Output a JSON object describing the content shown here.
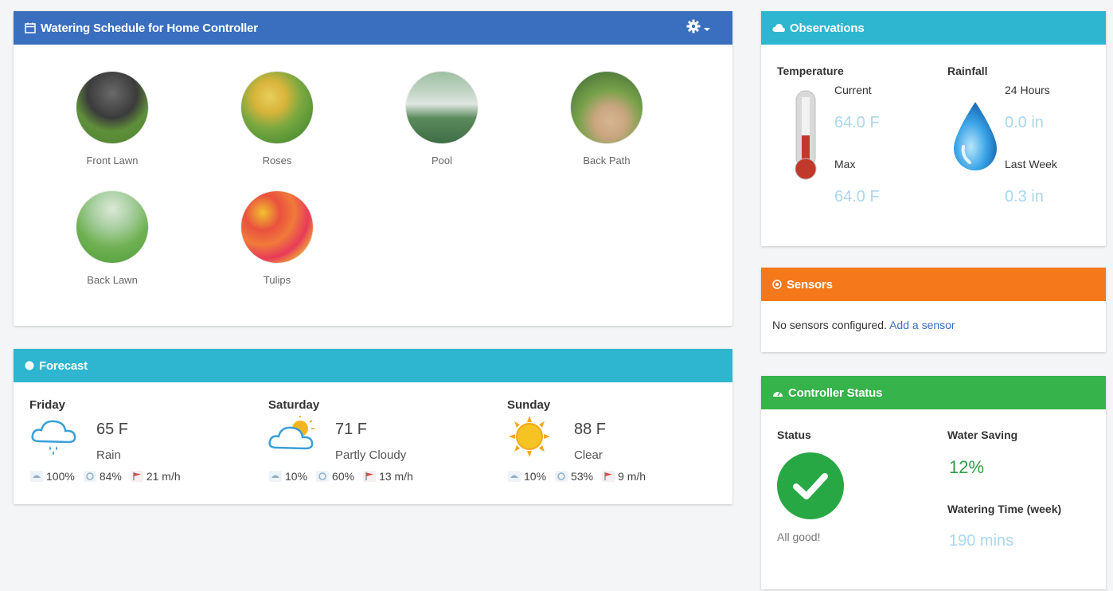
{
  "schedule": {
    "title": "Watering Schedule for Home Controller",
    "zones": [
      {
        "label": "Front Lawn",
        "colors": [
          "#3b3b3b",
          "#5f8f3a"
        ]
      },
      {
        "label": "Roses",
        "colors": [
          "#d9b43a",
          "#4e8f33"
        ]
      },
      {
        "label": "Pool",
        "colors": [
          "#c4d6c8",
          "#3f6d45"
        ]
      },
      {
        "label": "Back Path",
        "colors": [
          "#c9a57f",
          "#527c3c"
        ]
      },
      {
        "label": "Back Lawn",
        "colors": [
          "#a9cfa2",
          "#4f9c3b"
        ]
      },
      {
        "label": "Tulips",
        "colors": [
          "#e9513e",
          "#f2c12e"
        ]
      }
    ]
  },
  "forecast": {
    "title": "Forecast",
    "days": [
      {
        "name": "Friday",
        "temp": "65 F",
        "condition": "Rain",
        "icon": "rain-cloud-icon",
        "precip": "100%",
        "humidity": "84%",
        "wind": "21 m/h"
      },
      {
        "name": "Saturday",
        "temp": "71 F",
        "condition": "Partly Cloudy",
        "icon": "partly-cloudy-icon",
        "precip": "10%",
        "humidity": "60%",
        "wind": "13 m/h"
      },
      {
        "name": "Sunday",
        "temp": "88 F",
        "condition": "Clear",
        "icon": "sun-icon",
        "precip": "10%",
        "humidity": "53%",
        "wind": "9 m/h"
      }
    ]
  },
  "observations": {
    "title": "Observations",
    "temperature_label": "Temperature",
    "current_label": "Current",
    "current_value": "64.0 F",
    "max_label": "Max",
    "max_value": "64.0 F",
    "rainfall_label": "Rainfall",
    "h24_label": "24 Hours",
    "h24_value": "0.0 in",
    "week_label": "Last Week",
    "week_value": "0.3 in"
  },
  "sensors": {
    "title": "Sensors",
    "message": "No sensors configured.",
    "link": "Add a sensor"
  },
  "controller": {
    "title": "Controller Status",
    "status_label": "Status",
    "status_text": "All good!",
    "saving_label": "Water Saving",
    "saving_value": "12%",
    "time_label": "Watering Time (week)",
    "time_value": "190 mins"
  },
  "colors": {
    "schedule_header": "#3a6fbf",
    "forecast_header": "#2eb6d1",
    "observations_header": "#2eb6d1",
    "sensors_header": "#f5791a",
    "status_header": "#36b34a",
    "ok_green": "#27a844"
  }
}
